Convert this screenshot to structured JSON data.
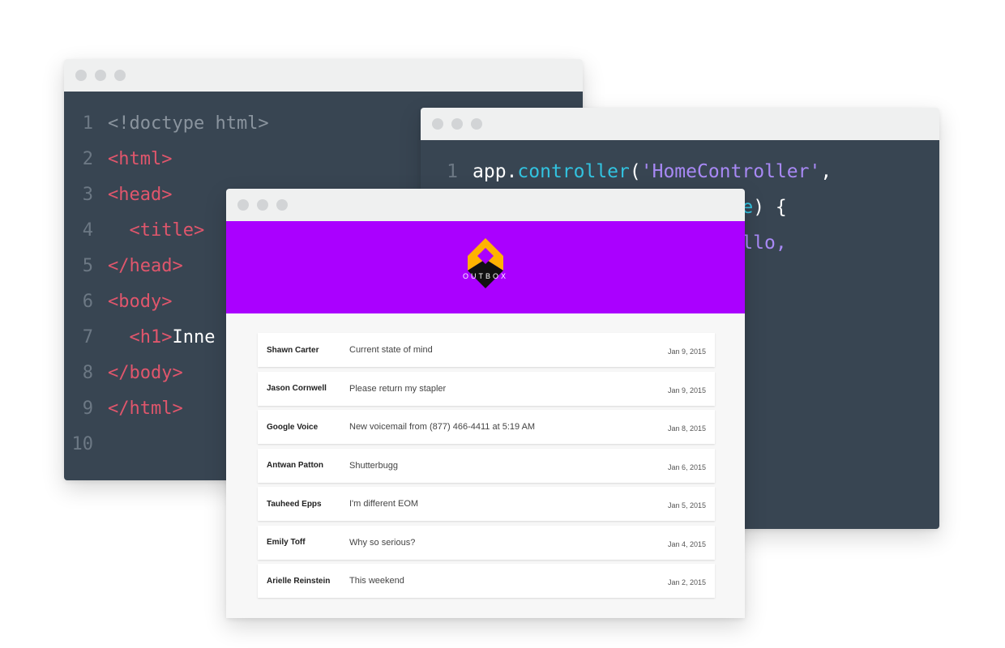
{
  "html_editor": {
    "lines": [
      {
        "num": "1",
        "parts": [
          {
            "cls": "doctype",
            "text": "<!doctype html>"
          }
        ]
      },
      {
        "num": "2",
        "parts": [
          {
            "cls": "tag",
            "text": "<html>"
          }
        ]
      },
      {
        "num": "3",
        "parts": [
          {
            "cls": "tag",
            "text": "<head>"
          }
        ]
      },
      {
        "num": "4",
        "parts": [
          {
            "cls": "tag",
            "text": "  <title>"
          }
        ]
      },
      {
        "num": "5",
        "parts": [
          {
            "cls": "tag",
            "text": "</head>"
          }
        ]
      },
      {
        "num": "6",
        "parts": [
          {
            "cls": "tag",
            "text": "<body>"
          }
        ]
      },
      {
        "num": "7",
        "parts": [
          {
            "cls": "tag",
            "text": "  <h1>"
          },
          {
            "cls": "plain",
            "text": "Inne"
          }
        ]
      },
      {
        "num": "8",
        "parts": [
          {
            "cls": "tag",
            "text": "</body>"
          }
        ]
      },
      {
        "num": "9",
        "parts": [
          {
            "cls": "tag",
            "text": "</html>"
          }
        ]
      },
      {
        "num": "10",
        "parts": []
      }
    ]
  },
  "js_editor": {
    "lines": [
      {
        "num": "1",
        "parts": [
          {
            "cls": "plain",
            "text": "app"
          },
          {
            "cls": "punc",
            "text": "."
          },
          {
            "cls": "method",
            "text": "controller"
          },
          {
            "cls": "punc",
            "text": "("
          },
          {
            "cls": "str",
            "text": "'HomeController'"
          },
          {
            "cls": "punc",
            "text": ","
          }
        ]
      },
      {
        "num": "",
        "parts": [
          {
            "cls": "plain",
            "text": "                      "
          },
          {
            "cls": "method",
            "text": "ope"
          },
          {
            "cls": "punc",
            "text": ") {"
          }
        ]
      },
      {
        "num": "",
        "parts": [
          {
            "cls": "plain",
            "text": "                      "
          },
          {
            "cls": "str",
            "text": "Hello,"
          }
        ]
      }
    ]
  },
  "app": {
    "brand": "OUTBOX",
    "colors": {
      "header": "#aa00ff",
      "logo_top": "#ffb300",
      "logo_bottom": "#111111"
    },
    "messages": [
      {
        "sender": "Shawn Carter",
        "subject": "Current state of mind",
        "date": "Jan 9, 2015"
      },
      {
        "sender": "Jason Cornwell",
        "subject": "Please return my stapler",
        "date": "Jan 9, 2015"
      },
      {
        "sender": "Google Voice",
        "subject": "New voicemail from (877) 466-4411 at 5:19 AM",
        "date": "Jan 8, 2015"
      },
      {
        "sender": "Antwan Patton",
        "subject": "Shutterbugg",
        "date": "Jan 6, 2015"
      },
      {
        "sender": "Tauheed Epps",
        "subject": "I'm different EOM",
        "date": "Jan 5, 2015"
      },
      {
        "sender": "Emily Toff",
        "subject": "Why so serious?",
        "date": "Jan 4, 2015"
      },
      {
        "sender": "Arielle Reinstein",
        "subject": "This weekend",
        "date": "Jan 2, 2015"
      }
    ]
  }
}
